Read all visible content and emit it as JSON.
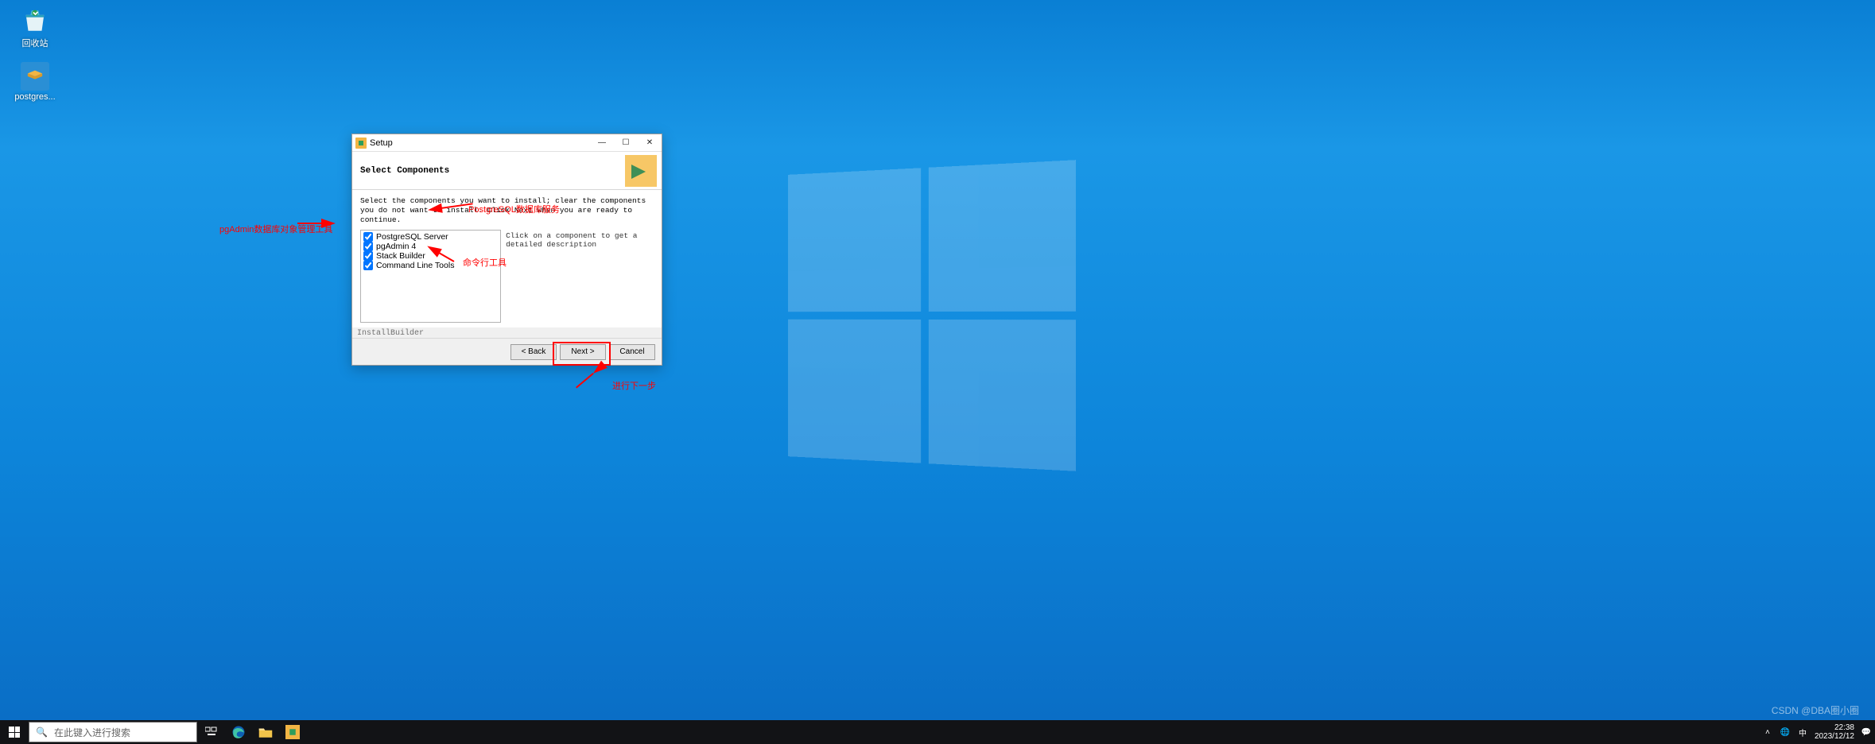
{
  "desktop_icons": {
    "recycle_bin": "回收站",
    "postgres": "postgres..."
  },
  "setup": {
    "title": "Setup",
    "header": "Select Components",
    "instruction": "Select the components you want to install; clear the components you do not want to install. Click Next when you are ready to continue.",
    "components": [
      {
        "label": "PostgreSQL Server",
        "checked": true
      },
      {
        "label": "pgAdmin 4",
        "checked": true
      },
      {
        "label": "Stack Builder",
        "checked": true
      },
      {
        "label": "Command Line Tools",
        "checked": true
      }
    ],
    "desc": "Click on a component to get a detailed description",
    "install_builder": "InstallBuilder",
    "buttons": {
      "back": "< Back",
      "next": "Next >",
      "cancel": "Cancel"
    }
  },
  "annotations": {
    "pgadmin": "pgAdmin数据库对象管理工具",
    "pg_service": "PostgreSQL数据库服务",
    "cli": "命令行工具",
    "next": "进行下一步"
  },
  "taskbar": {
    "search_placeholder": "在此键入进行搜索",
    "time": "22:38",
    "date": "2023/12/12"
  },
  "watermark": "CSDN @DBA圈小圈"
}
